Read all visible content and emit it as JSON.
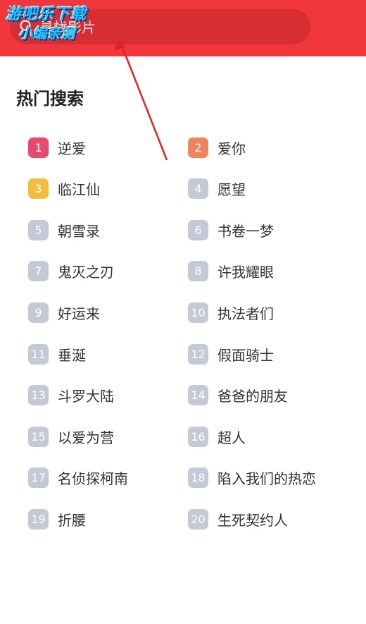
{
  "header": {
    "search_placeholder": "寻找影片",
    "watermark_line1": "游吧乐下载",
    "watermark_line2": "小编亲测",
    "bg_color": "#f2373c"
  },
  "hot_search": {
    "title": "热门搜索",
    "items": [
      {
        "rank": "1",
        "label": "逆爱",
        "color": "#e84a6f"
      },
      {
        "rank": "2",
        "label": "爱你",
        "color": "#f0845f"
      },
      {
        "rank": "3",
        "label": "临江仙",
        "color": "#f0be40"
      },
      {
        "rank": "4",
        "label": "愿望",
        "color": "#c3cad6"
      },
      {
        "rank": "5",
        "label": "朝雪录",
        "color": "#c3cad6"
      },
      {
        "rank": "6",
        "label": "书卷一梦",
        "color": "#c3cad6"
      },
      {
        "rank": "7",
        "label": "鬼灭之刃",
        "color": "#c3cad6"
      },
      {
        "rank": "8",
        "label": "许我耀眼",
        "color": "#c3cad6"
      },
      {
        "rank": "9",
        "label": "好运来",
        "color": "#c3cad6"
      },
      {
        "rank": "10",
        "label": "执法者们",
        "color": "#c3cad6"
      },
      {
        "rank": "11",
        "label": "垂涎",
        "color": "#c3cad6"
      },
      {
        "rank": "12",
        "label": "假面骑士",
        "color": "#c3cad6"
      },
      {
        "rank": "13",
        "label": "斗罗大陆",
        "color": "#c3cad6"
      },
      {
        "rank": "14",
        "label": "爸爸的朋友",
        "color": "#c3cad6"
      },
      {
        "rank": "15",
        "label": "以爱为营",
        "color": "#c3cad6"
      },
      {
        "rank": "16",
        "label": "超人",
        "color": "#c3cad6"
      },
      {
        "rank": "17",
        "label": "名侦探柯南",
        "color": "#c3cad6"
      },
      {
        "rank": "18",
        "label": "陷入我们的热恋",
        "color": "#c3cad6"
      },
      {
        "rank": "19",
        "label": "折腰",
        "color": "#c3cad6"
      },
      {
        "rank": "20",
        "label": "生死契约人",
        "color": "#c3cad6"
      }
    ]
  }
}
